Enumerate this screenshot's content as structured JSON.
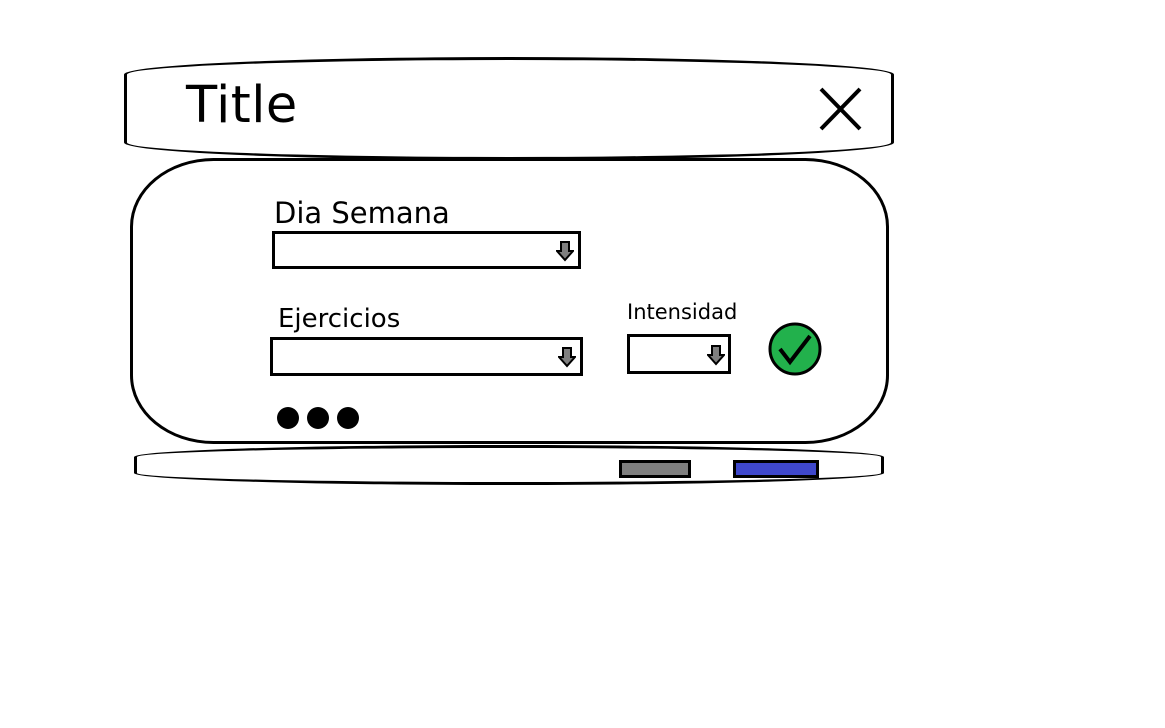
{
  "dialog": {
    "title": "Title",
    "close_icon": "close-icon",
    "fields": {
      "dia_semana": {
        "label": "Dia Semana",
        "value": "",
        "icon": "arrow-down-icon"
      },
      "ejercicios": {
        "label": "Ejercicios",
        "value": "",
        "icon": "arrow-down-icon"
      },
      "intensidad": {
        "label": "Intensidad",
        "value": "",
        "icon": "arrow-down-icon"
      }
    },
    "confirm_icon": "checkmark-icon",
    "more_icon": "more-dots-icon",
    "footer": {
      "secondary_color": "#7f7f7f",
      "primary_color": "#3f48cc"
    },
    "colors": {
      "confirm_green": "#22b14c",
      "arrow_fill": "#7f7f7f"
    }
  }
}
